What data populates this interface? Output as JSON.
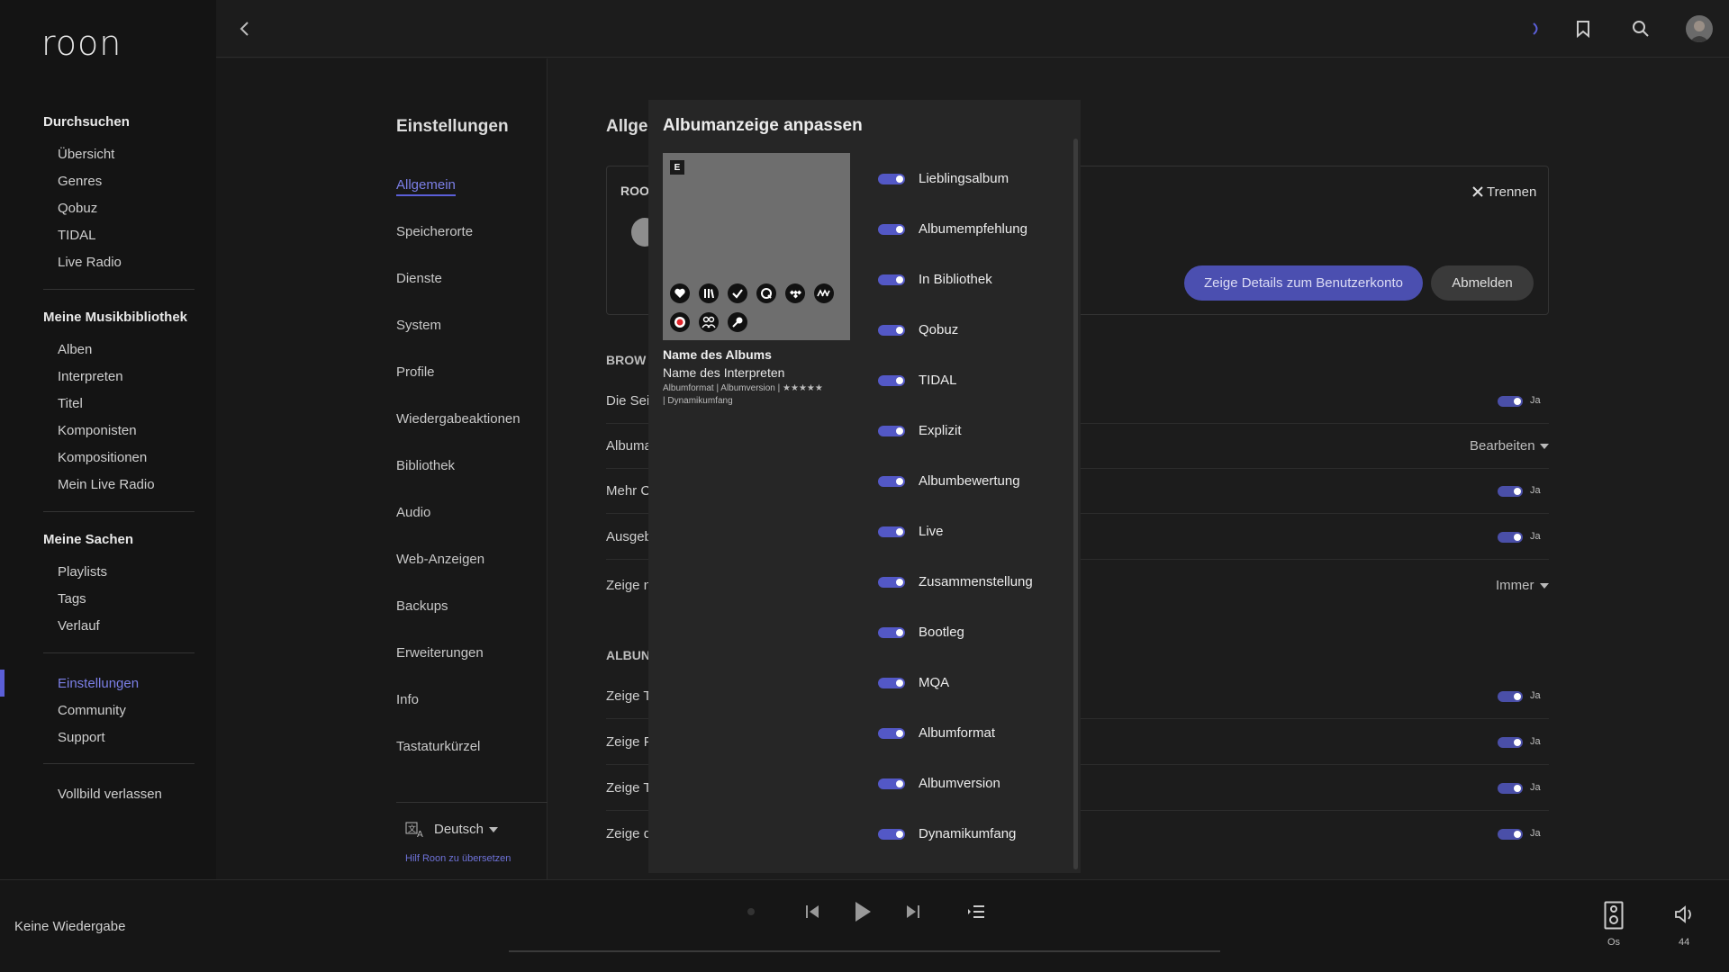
{
  "app": {
    "logo": "roon"
  },
  "sidebar": {
    "browse_title": "Durchsuchen",
    "browse_items": [
      "Übersicht",
      "Genres",
      "Qobuz",
      "TIDAL",
      "Live Radio"
    ],
    "library_title": "Meine Musikbibliothek",
    "library_items": [
      "Alben",
      "Interpreten",
      "Titel",
      "Komponisten",
      "Kompositionen",
      "Mein Live Radio"
    ],
    "my_stuff_title": "Meine Sachen",
    "my_stuff_items": [
      "Playlists",
      "Tags",
      "Verlauf"
    ],
    "other_items": [
      "Einstellungen",
      "Community",
      "Support"
    ],
    "exit_fullscreen": "Vollbild verlassen"
  },
  "settings_nav": {
    "title": "Einstellungen",
    "items": [
      "Allgemein",
      "Speicherorte",
      "Dienste",
      "System",
      "Profile",
      "Wiedergabeaktionen",
      "Bibliothek",
      "Audio",
      "Web-Anzeigen",
      "Backups",
      "Erweiterungen",
      "Info",
      "Tastaturkürzel"
    ],
    "language": "Deutsch",
    "translate_link": "Hilf Roon zu übersetzen"
  },
  "main": {
    "title_partial": "Allgen",
    "account_label_partial": "ROO",
    "disconnect": "Trennen",
    "details_button": "Zeige Details zum Benutzerkonto",
    "logout_button": "Abmelden",
    "browse_section": "BROW",
    "rows": [
      "Die Sei",
      "Albuma",
      "Mehr C",
      "Ausgeb",
      "Zeige n"
    ],
    "edit_label": "Bearbeiten",
    "always_label": "Immer",
    "album_section": "ALBUN",
    "album_rows": [
      "Zeige T",
      "Zeige P",
      "Zeige T",
      "Zeige d"
    ],
    "yes": "Ja"
  },
  "modal": {
    "title": "Albumanzeige anpassen",
    "badge": "E",
    "album_name": "Name des Albums",
    "artist_name": "Name des Interpreten",
    "meta_line1": "Albumformat | Albumversion | ★★★★★",
    "meta_line2": "| Dynamikumfang",
    "toggles": [
      "Lieblingsalbum",
      "Albumempfehlung",
      "In Bibliothek",
      "Qobuz",
      "TIDAL",
      "Explizit",
      "Albumbewertung",
      "Live",
      "Zusammenstellung",
      "Bootleg",
      "MQA",
      "Albumformat",
      "Albumversion",
      "Dynamikumfang"
    ]
  },
  "player": {
    "now_playing": "Keine Wiedergabe",
    "zone_label": "Os",
    "volume": "44"
  },
  "colors": {
    "accent": "#5b5fd8",
    "background": "#1c1c1c",
    "modal": "#262626"
  }
}
